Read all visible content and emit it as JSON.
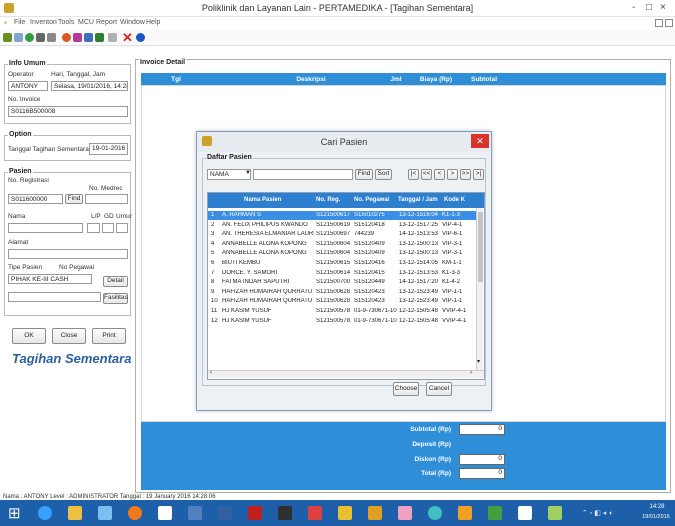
{
  "window": {
    "title": "Poliklinik dan Layanan Lain - PERTAMEDIKA - [Tagihan Sementara]",
    "controls": [
      "-",
      "□",
      "×"
    ]
  },
  "menu": [
    "File",
    "Inventori",
    "Tools",
    "MCU",
    "Report",
    "Window",
    "Help"
  ],
  "info_umum": {
    "title": "Info Umum",
    "operator_label": "Operator",
    "hari_label": "Hari, Tanggal, Jam",
    "operator": "ANTONY",
    "datetime": "Selasa, 19/01/2016, 14:28",
    "invoice_label": "No. Invoice",
    "invoice": "S0116B500008"
  },
  "option": {
    "title": "Option",
    "label": "Tanggal Tagihan Sementara",
    "value": "19-01-2016"
  },
  "pasien": {
    "title": "Pasien",
    "registrasi_label": "No. Registrasi",
    "medrec_label": "No. Medrec",
    "registrasi": "S011600000",
    "find_label": "Find",
    "nama_label": "Nama",
    "lp_label": "L/P",
    "gd_label": "GD",
    "umur_label": "Umur",
    "alamat_label": "Alamat",
    "tipe_label": "Tipe Pasien",
    "pegawai_label": "No Pegawai",
    "tipe": "PIHAK KE-III CASH",
    "detail_label": "Detail",
    "fasilitas_label": "Fasilitas"
  },
  "actions": {
    "ok": "OK",
    "close": "Close",
    "print": "Print"
  },
  "form_heading": "Tagihan Sementara",
  "invoice_detail": {
    "title": "Invoice Detail",
    "columns": [
      "Tgl",
      "Deskripsi",
      "Jml",
      "Biaya (Rp)",
      "Subtotal"
    ]
  },
  "summary": {
    "subtotal_label": "Subtotal (Rp)",
    "subtotal": "0",
    "deposit_label": "Deposit (Rp)",
    "diskon_label": "Diskon (Rp)",
    "diskon": "0",
    "total_label": "Total (Rp)",
    "total": "0"
  },
  "status_bar": "Nama : ANTONY   Level : ADMINISTRATOR   Tanggal : 19 January 2016 14:28:06",
  "dialog": {
    "title": "Cari Pasien",
    "group": "Daftar Pasien",
    "search_field": "NAMA",
    "find_label": "Find",
    "sort_label": "Sort",
    "nav": [
      "|<",
      "<<",
      "<",
      ">",
      ">>",
      ">|"
    ],
    "columns": [
      "Nama Pasien",
      "No. Reg.",
      "No. Pegawai",
      "Tanggal / Jam",
      "Kode K"
    ],
    "rows": [
      {
        "no": "1",
        "nama": "A. RAHMAN S",
        "reg": "S121500617",
        "peg": "S15010275",
        "tgl": "13-12-15",
        "jam": "16:04",
        "kode": "K1-1-3"
      },
      {
        "no": "2",
        "nama": "AN. FELIX PHILIPUS KWANDO",
        "reg": "S121500619",
        "peg": "S15120418",
        "tgl": "13-12-15",
        "jam": "17:25",
        "kode": "VIP-4-1"
      },
      {
        "no": "3",
        "nama": "AN. THERESIA ELMANIAR LAURI",
        "reg": "S121500697",
        "peg": "744239",
        "tgl": "14-12-15",
        "jam": "13:53",
        "kode": "VIP-6-1"
      },
      {
        "no": "4",
        "nama": "ANNABELLE ALONA KOPONG",
        "reg": "S121500604",
        "peg": "S15120409",
        "tgl": "13-12-15",
        "jam": "00:13",
        "kode": "VIP-3-1"
      },
      {
        "no": "5",
        "nama": "ANNABELLE ALONA KOPONG",
        "reg": "S121500604",
        "peg": "S15120409",
        "tgl": "13-12-15",
        "jam": "00:13",
        "kode": "VIP-3-1"
      },
      {
        "no": "6",
        "nama": "BIUTI KEMBU",
        "reg": "S121500615",
        "peg": "S15120416",
        "tgl": "13-12-15",
        "jam": "14:05",
        "kode": "KM-1-1"
      },
      {
        "no": "7",
        "nama": "DORCE. Y. SAMORI",
        "reg": "S121500614",
        "peg": "S15120415",
        "tgl": "13-12-15",
        "jam": "13:53",
        "kode": "K1-3-3"
      },
      {
        "no": "8",
        "nama": "FATMA INDAH SAPUTRI",
        "reg": "S121500700",
        "peg": "S15120449",
        "tgl": "14-12-15",
        "jam": "17:20",
        "kode": "K1-4-2"
      },
      {
        "no": "9",
        "nama": "HAFIZAH HUMAIRAH QURRATU",
        "reg": "S121500628",
        "peg": "S15120423",
        "tgl": "13-12-15",
        "jam": "23:49",
        "kode": "VIP-1-1"
      },
      {
        "no": "10",
        "nama": "HAFIZAH HUMAIRAH QURRATU",
        "reg": "S121500628",
        "peg": "S15120423",
        "tgl": "13-12-15",
        "jam": "23:49",
        "kode": "VIP-1-1"
      },
      {
        "no": "11",
        "nama": "HJ KASIM YUSUF",
        "reg": "S121500578",
        "peg": "01-9-730671-10",
        "tgl": "12-12-15",
        "jam": "05:48",
        "kode": "VVIP-4-1"
      },
      {
        "no": "12",
        "nama": "HJ KASIM YUSUF",
        "reg": "S121500578",
        "peg": "01-9-730671-10",
        "tgl": "12-12-15",
        "jam": "05:48",
        "kode": "VVIP-4-1"
      }
    ],
    "choose_label": "Choose",
    "cancel_label": "Cancel"
  },
  "taskbar": {
    "time": "14:28",
    "date": "19/01/2016"
  },
  "colors": {
    "accent": "#2e8fd8",
    "selection": "#3a8ee6",
    "taskbar": "#1d5fa8",
    "close": "#d9342b",
    "heading": "#2a5fa0"
  }
}
